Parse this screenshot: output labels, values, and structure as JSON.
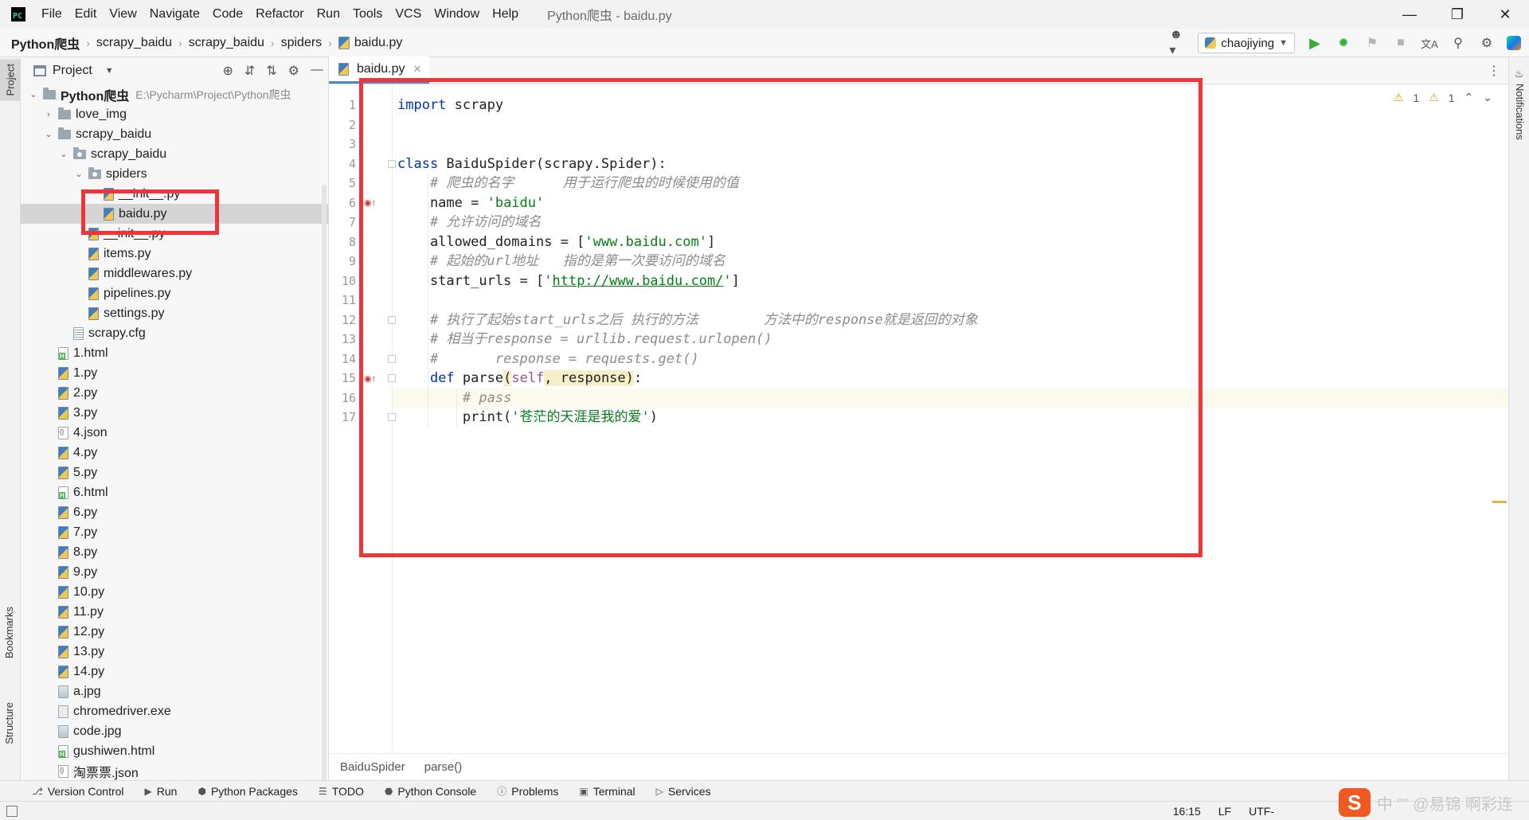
{
  "window": {
    "title": "Python爬虫 - baidu.py",
    "menu": [
      "File",
      "Edit",
      "View",
      "Navigate",
      "Code",
      "Refactor",
      "Run",
      "Tools",
      "VCS",
      "Window",
      "Help"
    ],
    "app_logo_text": "PC"
  },
  "breadcrumb": [
    "Python爬虫",
    "scrapy_baidu",
    "scrapy_baidu",
    "spiders",
    "baidu.py"
  ],
  "toolbar": {
    "run_config": "chaojiying",
    "icons": [
      "user-icon",
      "run-icon",
      "debug-icon",
      "coverage-icon",
      "stop-icon",
      "translate-icon",
      "search-icon",
      "settings-icon",
      "jetbrains-icon"
    ]
  },
  "side_stripes": {
    "left": [
      "Project",
      "Bookmarks",
      "Structure"
    ],
    "right": [
      "Notifications"
    ]
  },
  "project_panel": {
    "title": "Project",
    "root_label": "Python爬虫",
    "root_path": "E:\\Pycharm\\Project\\Python爬虫",
    "items": [
      {
        "label": "love_img",
        "type": "folder",
        "depth": 1,
        "arrow": "›"
      },
      {
        "label": "scrapy_baidu",
        "type": "folder",
        "depth": 1,
        "arrow": "⌄"
      },
      {
        "label": "scrapy_baidu",
        "type": "package",
        "depth": 2,
        "arrow": "⌄"
      },
      {
        "label": "spiders",
        "type": "package",
        "depth": 3,
        "arrow": "⌄"
      },
      {
        "label": "__init__.py",
        "type": "py",
        "depth": 4
      },
      {
        "label": "baidu.py",
        "type": "py",
        "depth": 4,
        "selected": true
      },
      {
        "label": "__init__.py",
        "type": "py",
        "depth": 3
      },
      {
        "label": "items.py",
        "type": "py",
        "depth": 3
      },
      {
        "label": "middlewares.py",
        "type": "py",
        "depth": 3
      },
      {
        "label": "pipelines.py",
        "type": "py",
        "depth": 3
      },
      {
        "label": "settings.py",
        "type": "py",
        "depth": 3
      },
      {
        "label": "scrapy.cfg",
        "type": "cfg",
        "depth": 2
      },
      {
        "label": "1.html",
        "type": "html",
        "depth": 1
      },
      {
        "label": "1.py",
        "type": "py",
        "depth": 1
      },
      {
        "label": "2.py",
        "type": "py",
        "depth": 1
      },
      {
        "label": "3.py",
        "type": "py",
        "depth": 1
      },
      {
        "label": "4.json",
        "type": "json",
        "depth": 1
      },
      {
        "label": "4.py",
        "type": "py",
        "depth": 1
      },
      {
        "label": "5.py",
        "type": "py",
        "depth": 1
      },
      {
        "label": "6.html",
        "type": "html",
        "depth": 1
      },
      {
        "label": "6.py",
        "type": "py",
        "depth": 1
      },
      {
        "label": "7.py",
        "type": "py",
        "depth": 1
      },
      {
        "label": "8.py",
        "type": "py",
        "depth": 1
      },
      {
        "label": "9.py",
        "type": "py",
        "depth": 1
      },
      {
        "label": "10.py",
        "type": "py",
        "depth": 1
      },
      {
        "label": "11.py",
        "type": "py",
        "depth": 1
      },
      {
        "label": "12.py",
        "type": "py",
        "depth": 1
      },
      {
        "label": "13.py",
        "type": "py",
        "depth": 1
      },
      {
        "label": "14.py",
        "type": "py",
        "depth": 1
      },
      {
        "label": "a.jpg",
        "type": "img",
        "depth": 1
      },
      {
        "label": "chromedriver.exe",
        "type": "exe",
        "depth": 1
      },
      {
        "label": "code.jpg",
        "type": "img",
        "depth": 1
      },
      {
        "label": "gushiwen.html",
        "type": "html",
        "depth": 1
      },
      {
        "label": "淘票票.json",
        "type": "json",
        "depth": 1
      }
    ]
  },
  "editor": {
    "tab_label": "baidu.py",
    "inspections": {
      "warnings_a": "1",
      "warnings_b": "1"
    },
    "current_line": 16,
    "lines": [
      {
        "n": "1",
        "tokens": [
          [
            "kw",
            "import"
          ],
          [
            "",
            " scrapy"
          ]
        ]
      },
      {
        "n": "2",
        "tokens": []
      },
      {
        "n": "3",
        "tokens": []
      },
      {
        "n": "4",
        "tokens": [
          [
            "kw",
            "class"
          ],
          [
            "",
            " BaiduSpider(scrapy.Spider):"
          ]
        ]
      },
      {
        "n": "5",
        "tokens": [
          [
            "",
            "    "
          ],
          [
            "cmt",
            "# 爬虫的名字      用于运行爬虫的时候使用的值"
          ]
        ]
      },
      {
        "n": "6",
        "tokens": [
          [
            "",
            "    name = "
          ],
          [
            "str",
            "'baidu'"
          ]
        ],
        "marker": "override"
      },
      {
        "n": "7",
        "tokens": [
          [
            "",
            "    "
          ],
          [
            "cmt",
            "# 允许访问的域名"
          ]
        ]
      },
      {
        "n": "8",
        "tokens": [
          [
            "",
            "    allowed_domains = ["
          ],
          [
            "str",
            "'www.baidu.com'"
          ],
          [
            "",
            "]"
          ]
        ]
      },
      {
        "n": "9",
        "tokens": [
          [
            "",
            "    "
          ],
          [
            "cmt",
            "# 起始的url地址   指的是第一次要访问的域名"
          ]
        ]
      },
      {
        "n": "10",
        "tokens": [
          [
            "",
            "    start_urls = ["
          ],
          [
            "str",
            "'"
          ],
          [
            "url",
            "http://www.baidu.com/"
          ],
          [
            "str",
            "'"
          ],
          [
            "",
            "]"
          ]
        ]
      },
      {
        "n": "11",
        "tokens": []
      },
      {
        "n": "12",
        "tokens": [
          [
            "",
            "    "
          ],
          [
            "cmt",
            "# 执行了起始start_urls之后 执行的方法        方法中的response就是返回的对象"
          ]
        ]
      },
      {
        "n": "13",
        "tokens": [
          [
            "",
            "    "
          ],
          [
            "cmt",
            "# 相当于response = urllib.request.urlopen()"
          ]
        ]
      },
      {
        "n": "14",
        "tokens": [
          [
            "",
            "    "
          ],
          [
            "cmt",
            "#       response = requests.get()"
          ]
        ]
      },
      {
        "n": "15",
        "tokens": [
          [
            "",
            "    "
          ],
          [
            "kw",
            "def"
          ],
          [
            "",
            " parse"
          ],
          [
            "param",
            "("
          ],
          [
            "slf",
            "self"
          ],
          [
            "param",
            ", response)"
          ],
          [
            "",
            ":"
          ]
        ],
        "marker": "override"
      },
      {
        "n": "16",
        "tokens": [
          [
            "",
            "        "
          ],
          [
            "cmt",
            "# pass"
          ]
        ]
      },
      {
        "n": "17",
        "tokens": [
          [
            "",
            "        print("
          ],
          [
            "str",
            "'苍茫的天涯是我的爱'"
          ],
          [
            "",
            ")"
          ]
        ]
      }
    ],
    "breadcrumb": [
      "BaiduSpider",
      "parse()"
    ]
  },
  "bottom_tools": [
    "Version Control",
    "Run",
    "Python Packages",
    "TODO",
    "Python Console",
    "Problems",
    "Terminal",
    "Services"
  ],
  "status": {
    "position": "16:15",
    "line_sep": "LF",
    "encoding": "UTF-"
  },
  "watermark": "中 \"\"  @易锦  啊彩连",
  "colors": {
    "accent": "#4a88c7",
    "highlight_box": "#f0343a",
    "keyword": "#0033b3",
    "string": "#067d17",
    "comment": "#8c8c8c"
  }
}
